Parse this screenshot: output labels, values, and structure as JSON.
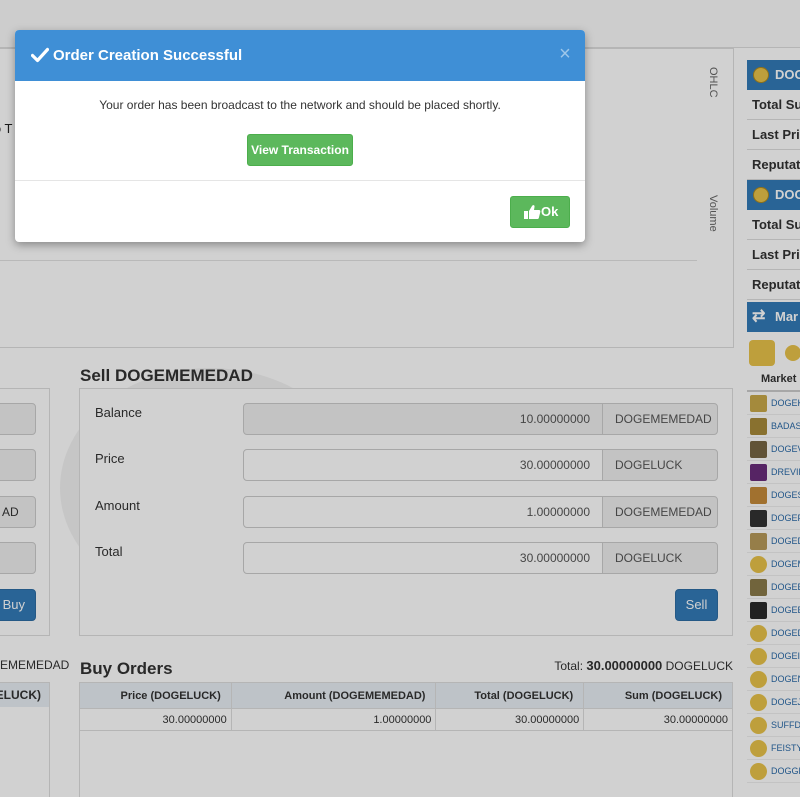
{
  "modal": {
    "title": "Order Creation Successful",
    "message": "Your order has been broadcast to the network and should be placed shortly.",
    "view_button": "View Transaction",
    "ok_button": "Ok",
    "close_glyph": "×",
    "header_color": "#3f8fd6",
    "button_color": "#5cb85c"
  },
  "chart": {
    "partial_label": "lo T",
    "side_label_top": "OHLC",
    "side_label_bottom": "Volume"
  },
  "buy_panel": {
    "amount_partial": "AD",
    "buy_button": "Buy",
    "total_partial": "EMEMEDAD",
    "table_head_partial": "ELUCK)"
  },
  "sell": {
    "title": "Sell DOGEMEMEDAD",
    "rows": [
      {
        "label": "Balance",
        "value": "10.00000000",
        "unit": "DOGEMEMEDAD"
      },
      {
        "label": "Price",
        "value": "30.00000000",
        "unit": "DOGELUCK"
      },
      {
        "label": "Amount",
        "value": "1.00000000",
        "unit": "DOGEMEMEDAD"
      },
      {
        "label": "Total",
        "value": "30.00000000",
        "unit": "DOGELUCK"
      }
    ],
    "sell_button": "Sell"
  },
  "buy_orders": {
    "title": "Buy Orders",
    "total_label": "Total:",
    "total_value": "30.00000000",
    "total_unit": "DOGELUCK",
    "columns": [
      "Price (DOGELUCK)",
      "Amount (DOGEMEMEDAD)",
      "Total (DOGELUCK)",
      "Sum (DOGELUCK)"
    ],
    "rows": [
      [
        "30.00000000",
        "1.00000000",
        "30.00000000",
        "30.00000000"
      ]
    ]
  },
  "right": {
    "header1": "DOG",
    "rows1": [
      "Total Su",
      "Last Pri",
      "Reputat"
    ],
    "header2": "DOG",
    "rows2": [
      "Total Su",
      "Last Pri",
      "Reputat"
    ],
    "markets_header": "Mar",
    "market_col": "Market",
    "markets": [
      "DOGEKA",
      "BADASS",
      "DOGEVA",
      "DREVIL",
      "DOGESI",
      "DOGEFO",
      "DOGEDO",
      "DOGEM",
      "DOGEBI",
      "DOGEBI",
      "DOGEDI",
      "DOGEIL",
      "DOGENI",
      "DOGEJU",
      "SUFFDO",
      "FEISTY",
      "DOGGFA"
    ]
  }
}
